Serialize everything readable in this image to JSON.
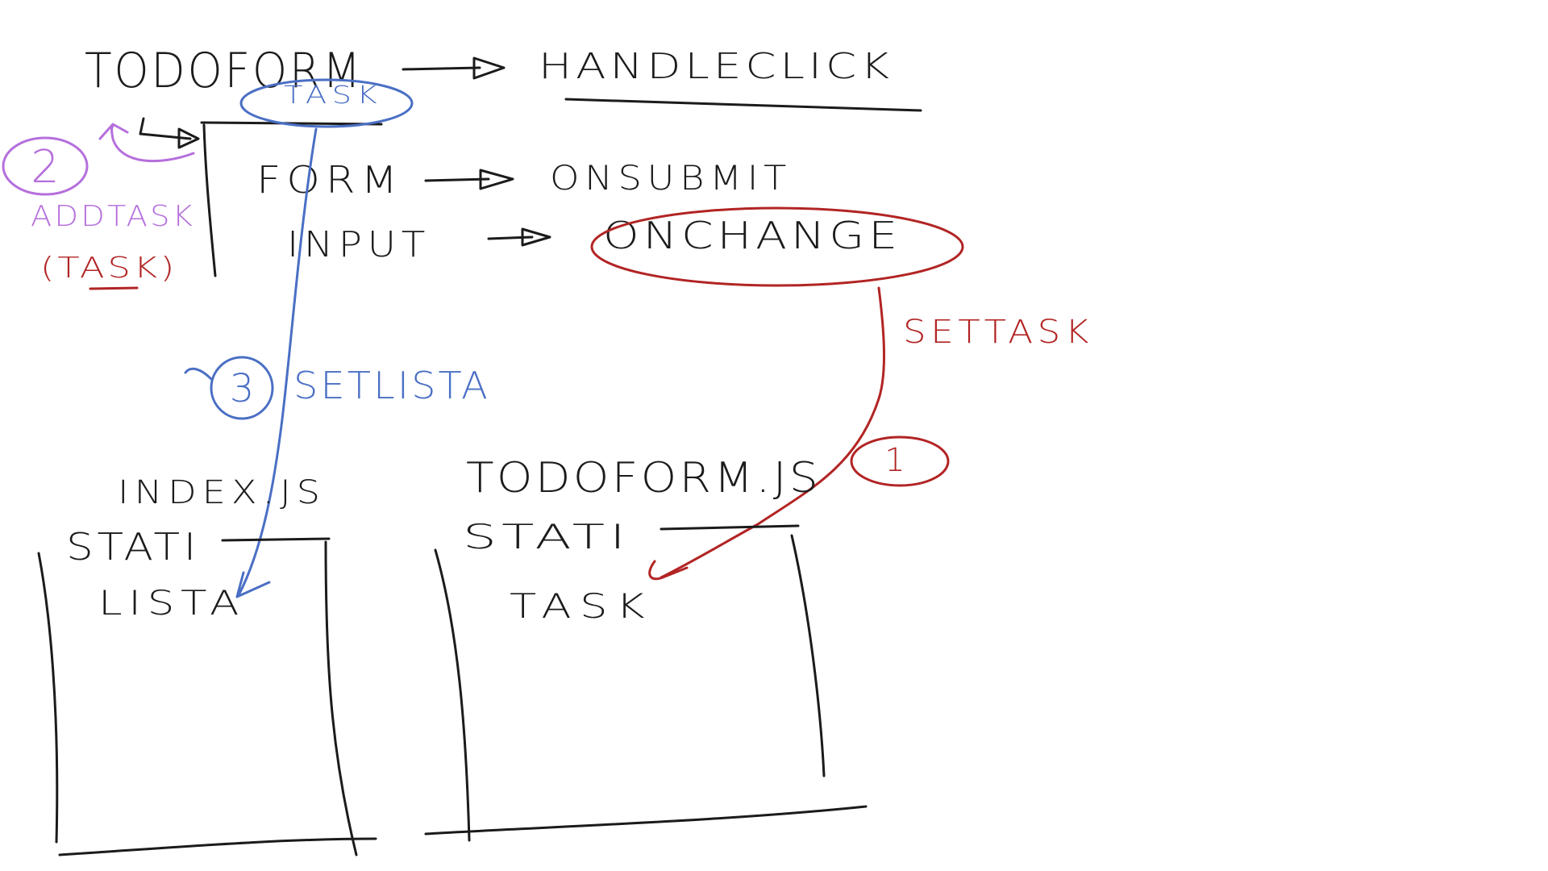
{
  "colors": {
    "ink": "#1b1b1b",
    "blue": "#4a6fc4",
    "red": "#b22424",
    "purple": "#b56fdc",
    "background": "#ffffff"
  },
  "labels": {
    "todoform": "TODOFORM",
    "handleclick": "HANDLECLICK",
    "task_top": "TASK",
    "form": "FORM",
    "onsubmit": "ONSUBMIT",
    "input": "INPUT",
    "onchange": "ONCHANGE",
    "step2_number": "2",
    "addtask": "ADDTASK",
    "addtask_arg": "(TASK)",
    "settask": "SETTASK",
    "step3_number": "3",
    "setlista": "SETLISTA",
    "step1_number": "1",
    "index_file": "INDEX.JS",
    "todoform_file": "TODOFORM.JS",
    "index_state": "STATI",
    "todoform_state": "STATI",
    "lista": "LISTA",
    "task_state": "TASK"
  },
  "arrow_heads": {
    "to_handleclick": "arrow-head",
    "to_onsubmit": "arrow-head",
    "to_onchange": "arrow-head"
  }
}
